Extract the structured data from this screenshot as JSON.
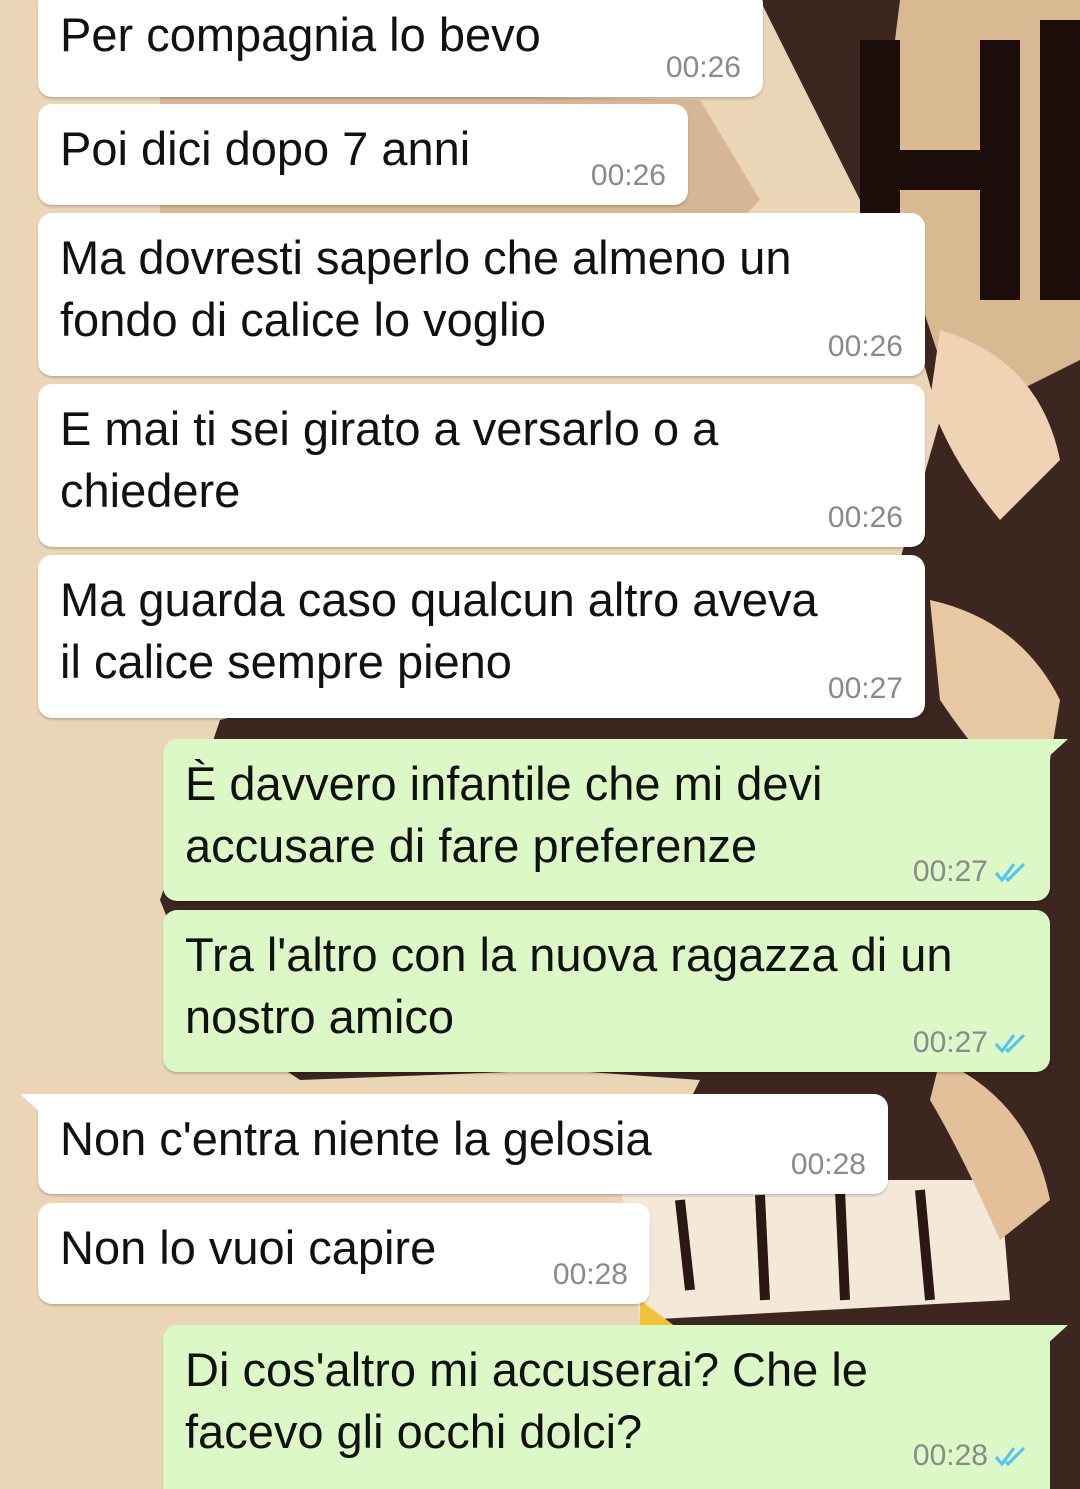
{
  "colors": {
    "incoming_bubble": "#ffffff",
    "outgoing_bubble": "#dcf8c6",
    "timestamp": "#8a8a8a",
    "read_ticks": "#4fc3f7",
    "wallpaper_light": "#ead5b6",
    "wallpaper_dark": "#2a1512"
  },
  "messages": [
    {
      "direction": "in",
      "text": "Per compagnia lo bevo",
      "time": "00:26"
    },
    {
      "direction": "in",
      "text": "Poi dici dopo 7 anni",
      "time": "00:26"
    },
    {
      "direction": "in",
      "text": "Ma dovresti saperlo che almeno un\nfondo di calice lo voglio",
      "time": "00:26"
    },
    {
      "direction": "in",
      "text": "E mai ti sei girato a versarlo o a\nchiedere",
      "time": "00:26"
    },
    {
      "direction": "in",
      "text": "Ma guarda caso qualcun altro aveva\nil calice sempre pieno",
      "time": "00:27"
    },
    {
      "direction": "out",
      "text": "È davvero infantile che mi devi\naccusare di fare preferenze",
      "time": "00:27",
      "status_icon": "double-check-read-icon"
    },
    {
      "direction": "out",
      "text": "Tra l'altro con la nuova ragazza di un\nnostro amico",
      "time": "00:27",
      "status_icon": "double-check-read-icon"
    },
    {
      "direction": "in",
      "text": "Non c'entra niente la gelosia",
      "time": "00:28"
    },
    {
      "direction": "in",
      "text": "Non lo vuoi capire",
      "time": "00:28"
    },
    {
      "direction": "out",
      "text": "Di cos'altro mi accuserai? Che le\nfacevo gli occhi dolci?",
      "time": "00:28",
      "status_icon": "double-check-read-icon"
    }
  ]
}
